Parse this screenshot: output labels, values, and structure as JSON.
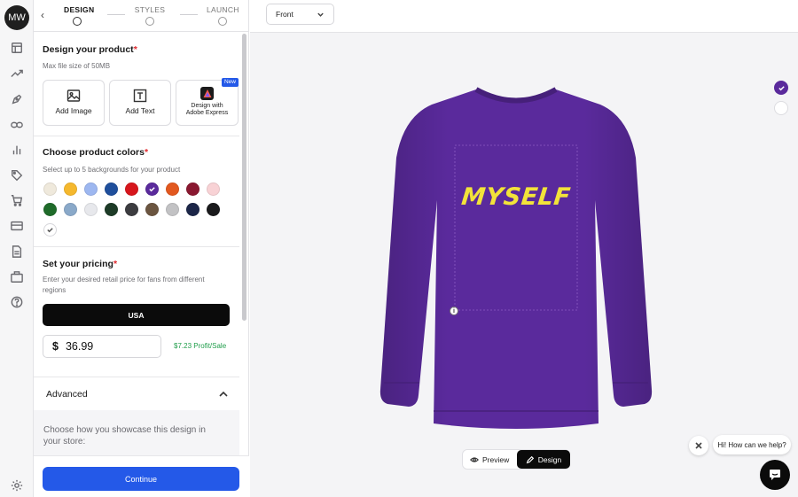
{
  "rail": {
    "avatar": "MW",
    "icons": [
      "layout-icon",
      "trending-icon",
      "pen-tool-icon",
      "link-icon",
      "bar-chart-icon",
      "tag-icon",
      "cart-icon",
      "card-icon",
      "document-icon",
      "briefcase-icon",
      "help-icon",
      "settings-icon"
    ]
  },
  "stepper": {
    "steps": [
      {
        "label": "DESIGN",
        "active": true
      },
      {
        "label": "STYLES",
        "active": false
      },
      {
        "label": "LAUNCH",
        "active": false
      }
    ]
  },
  "design_section": {
    "title": "Design your product",
    "required": "*",
    "subtitle": "Max file size of 50MB",
    "cards": [
      {
        "label": "Add Image",
        "icon": "image-icon"
      },
      {
        "label": "Add Text",
        "icon": "text-icon"
      },
      {
        "label": "Design with Adobe Express",
        "icon": "adobe-express-icon",
        "badge": "New"
      }
    ]
  },
  "colors_section": {
    "title": "Choose product colors",
    "required": "*",
    "subtitle": "Select up to 5 backgrounds for your product",
    "swatches": [
      {
        "name": "natural",
        "color": "#efe9dc"
      },
      {
        "name": "gold",
        "color": "#f5b82e"
      },
      {
        "name": "light-blue",
        "color": "#9db7f0"
      },
      {
        "name": "royal",
        "color": "#1f4f9c"
      },
      {
        "name": "red",
        "color": "#d7161c"
      },
      {
        "name": "purple",
        "color": "#5a2a9c",
        "selected": true
      },
      {
        "name": "orange",
        "color": "#e2581f"
      },
      {
        "name": "maroon",
        "color": "#8a1830"
      },
      {
        "name": "light-pink",
        "color": "#f8d2d5"
      },
      {
        "name": "kelly-green",
        "color": "#1f6b2a"
      },
      {
        "name": "dusty-blue",
        "color": "#8aa9c9"
      },
      {
        "name": "ash",
        "color": "#e7e8ec"
      },
      {
        "name": "forest",
        "color": "#1d3b27"
      },
      {
        "name": "charcoal",
        "color": "#3c3c40"
      },
      {
        "name": "brown",
        "color": "#6b5540"
      },
      {
        "name": "sport-grey",
        "color": "#c2c2c4"
      },
      {
        "name": "navy",
        "color": "#1c2648"
      },
      {
        "name": "black",
        "color": "#1a1a1c"
      },
      {
        "name": "white",
        "color": "#ffffff",
        "selected": true,
        "check_dark": true
      }
    ]
  },
  "pricing_section": {
    "title": "Set your pricing",
    "required": "*",
    "subtitle": "Enter your desired retail price for fans from different regions",
    "region_button": "USA",
    "currency": "$",
    "price": "36.99",
    "profit": "$7.23 Profit/Sale"
  },
  "advanced": {
    "title": "Advanced",
    "question": "Choose how you showcase this design in your store:"
  },
  "footer": {
    "continue": "Continue"
  },
  "canvas": {
    "view": "Front",
    "print_text": "MYSELF",
    "shirt_color": "#5a2a9c",
    "print_color": "#f2e33a",
    "color_pickers": [
      {
        "color": "#5a2a9c",
        "selected": true
      },
      {
        "color": "#ffffff",
        "selected": false
      }
    ],
    "toggle": {
      "preview": "Preview",
      "design": "Design"
    },
    "chat": {
      "bubble": "Hi! How can we help?"
    }
  },
  "colors": {
    "accent": "#2459e8",
    "profit_green": "#1f9d4a",
    "required_red": "#e0282e"
  }
}
